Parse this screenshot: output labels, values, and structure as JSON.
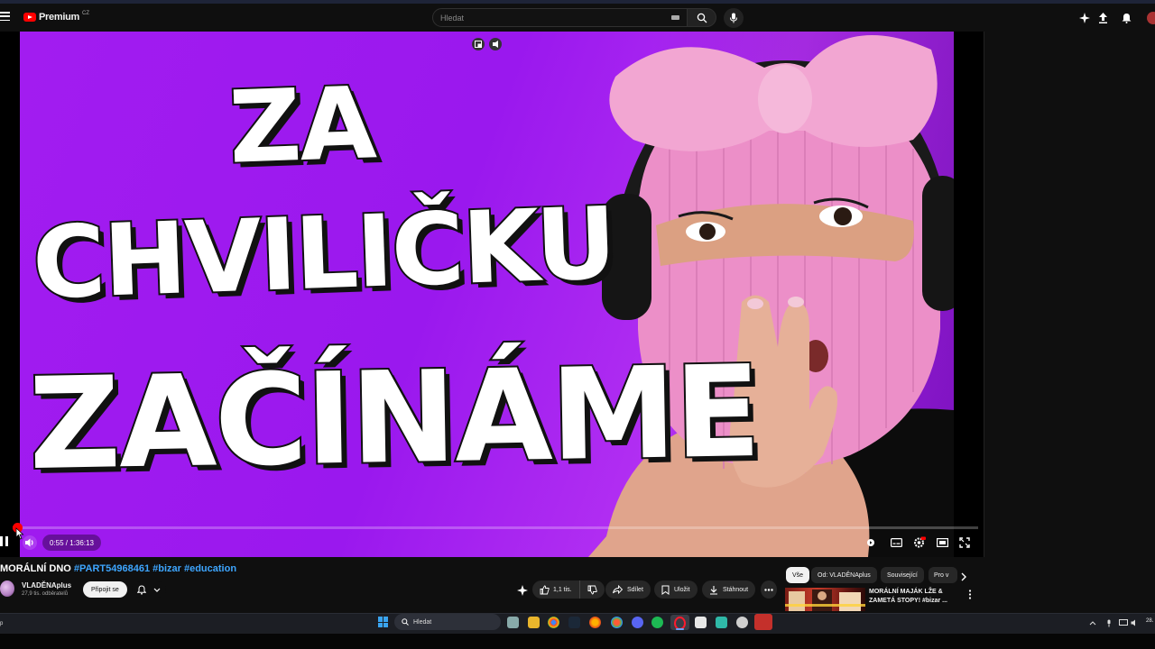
{
  "header": {
    "brand": "Premium",
    "brand_region": "CZ",
    "search_placeholder": "Hledat",
    "icons": [
      "menu-icon",
      "youtube-logo-icon",
      "keyboard-icon",
      "search-icon",
      "mic-icon",
      "create-icon",
      "upload-icon",
      "bell-icon",
      "avatar"
    ]
  },
  "video": {
    "thumbnail_text": [
      "ZA",
      "CHVILIČKU",
      "ZAČÍNÁME"
    ],
    "time": "0:55 / 1:36:13",
    "progress_fraction": 0.0095,
    "controls": [
      "pause-icon",
      "volume-icon",
      "autoplay-toggle",
      "subtitles-icon",
      "settings-icon",
      "theater-icon",
      "fullscreen-icon"
    ],
    "title_prefix": "MORÁLNÍ DNO ",
    "tags": "#PART54968461 #bizar #education"
  },
  "channel": {
    "name": "VLADĚNAplus",
    "subscribers": "27,9 tis. odběratelů",
    "join_label": "Připojit se"
  },
  "actions": {
    "likes": "1,1 tis.",
    "share": "Sdílet",
    "save": "Uložit",
    "download": "Stáhnout"
  },
  "chips": [
    "Vše",
    "Od: VLADĚNAplus",
    "Související",
    "Pro v"
  ],
  "recommendation": {
    "title": "MORÁLNÍ MAJÁK LŽE & ZAMETÁ STOPY! #bizar ..."
  },
  "taskbar": {
    "search_label": "Hledat",
    "edge_text": "p",
    "clock_text": "28."
  },
  "colors": {
    "accent_red": "#ff0000",
    "link_blue": "#3ea6ff",
    "thumbnail_purple": "#a21cf0",
    "mask_pink": "#ec8fc8"
  }
}
